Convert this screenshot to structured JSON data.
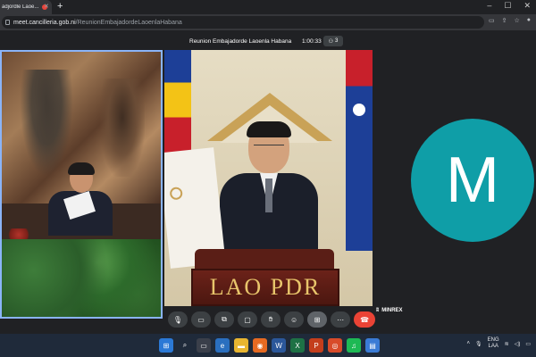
{
  "browser": {
    "tab_title": "adjordle Laoe...",
    "new_tab_icon": "plus-icon",
    "url_host": "meet.cancilleria.gob.ni",
    "url_path": "/ReunionEmbajadordeLaoenlaHabana"
  },
  "meet": {
    "title": "Reunion Embajadorde Laoenla Habana",
    "timer": "1:00:33",
    "participants_count": "3",
    "participant_name": "MINREX",
    "avatar_letter": "M",
    "avatar_color": "#0f9ea7",
    "plaque_text": "LAO PDR",
    "controls": [
      "mic-icon",
      "camera-icon",
      "present-icon",
      "chat-icon",
      "raise-hand-icon",
      "reactions-icon",
      "grid-icon",
      "more-icon",
      "end-call-icon"
    ]
  },
  "taskbar": {
    "lang_top": "ENG",
    "lang_bottom": "LAA"
  }
}
